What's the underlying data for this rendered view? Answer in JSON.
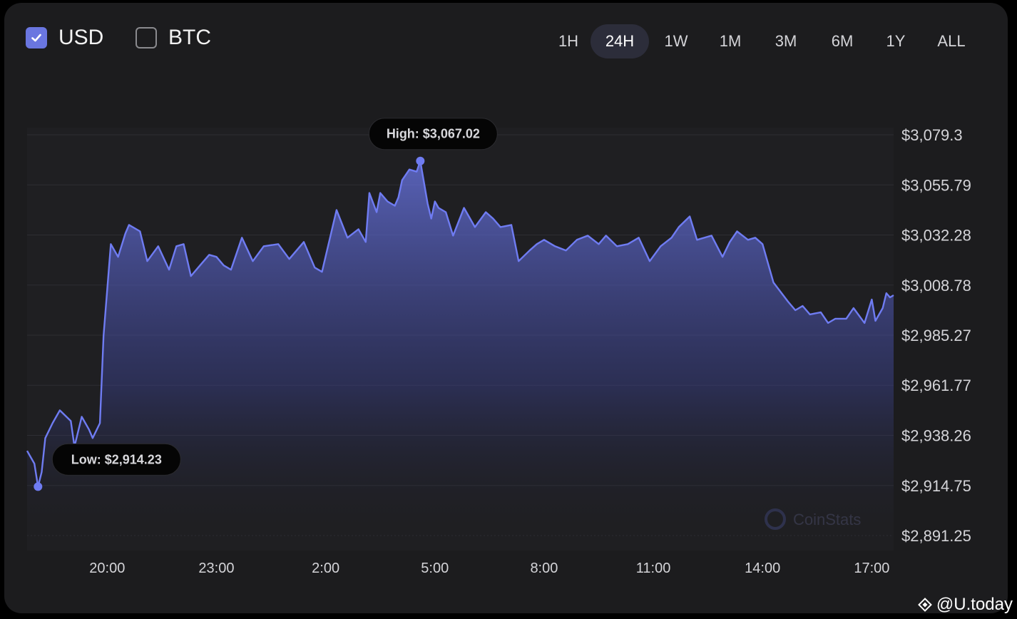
{
  "currency_toggles": [
    {
      "label": "USD",
      "checked": true
    },
    {
      "label": "BTC",
      "checked": false
    }
  ],
  "ranges": [
    "1H",
    "24H",
    "1W",
    "1M",
    "3M",
    "6M",
    "1Y",
    "ALL"
  ],
  "active_range": "24H",
  "watermark": "CoinStats",
  "brand": "@U.today",
  "colors": {
    "line": "#6f7cf2",
    "accent": "#6a76e0",
    "background": "#1c1c1e"
  },
  "chart_data": {
    "type": "area",
    "y_tick_labels": [
      "$3,079.3",
      "$3,055.79",
      "$3,032.28",
      "$3,008.78",
      "$2,985.27",
      "$2,961.77",
      "$2,938.26",
      "$2,914.75",
      "$2,891.25"
    ],
    "y_ticks": [
      3079.3,
      3055.79,
      3032.28,
      3008.78,
      2985.27,
      2961.77,
      2938.26,
      2914.75,
      2891.25
    ],
    "ylim": [
      2891.25,
      3079.3
    ],
    "x_tick_labels": [
      "20:00",
      "23:00",
      "2:00",
      "5:00",
      "8:00",
      "11:00",
      "14:00",
      "17:00"
    ],
    "x_ticks": [
      20,
      23,
      26,
      29,
      32,
      35,
      38,
      41
    ],
    "xlim": [
      17.8,
      41.6
    ],
    "grid": true,
    "series": [
      {
        "x": [
          17.8,
          18.0,
          18.1,
          18.2,
          18.3,
          18.5,
          18.7,
          19.0,
          19.1,
          19.3,
          19.5,
          19.6,
          19.8,
          19.9,
          20.1,
          20.3,
          20.5,
          20.6,
          20.9,
          21.1,
          21.4,
          21.7,
          21.9,
          22.1,
          22.3,
          22.6,
          22.8,
          23.0,
          23.2,
          23.4,
          23.7,
          24.0,
          24.3,
          24.7,
          25.0,
          25.4,
          25.7,
          25.9,
          26.3,
          26.6,
          26.9,
          27.1,
          27.2,
          27.4,
          27.5,
          27.7,
          27.9,
          28.0,
          28.1,
          28.3,
          28.5,
          28.6,
          28.8,
          28.9,
          29.0,
          29.1,
          29.3,
          29.5,
          29.8,
          30.1,
          30.4,
          30.6,
          30.8,
          31.1,
          31.3,
          31.6,
          31.8,
          32.0,
          32.3,
          32.6,
          32.9,
          33.2,
          33.5,
          33.7,
          34.0,
          34.3,
          34.6,
          34.9,
          35.2,
          35.5,
          35.7,
          36.0,
          36.2,
          36.6,
          36.9,
          37.1,
          37.3,
          37.6,
          37.8,
          38.0,
          38.3,
          38.7,
          38.9,
          39.1,
          39.3,
          39.6,
          39.8,
          40.0,
          40.3,
          40.5,
          40.8,
          41.0,
          41.1,
          41.3,
          41.4,
          41.5,
          41.6
        ],
        "y": [
          2931,
          2925,
          2914.23,
          2921,
          2937,
          2944,
          2950,
          2945,
          2933,
          2947,
          2941,
          2937,
          2944,
          2985,
          3028,
          3022,
          3033,
          3037,
          3034,
          3020,
          3027,
          3016,
          3027,
          3028,
          3013,
          3019,
          3023,
          3022,
          3018,
          3016,
          3031,
          3020,
          3027,
          3028,
          3021,
          3029,
          3017,
          3015,
          3044,
          3031,
          3035,
          3029,
          3052,
          3043,
          3052,
          3048,
          3046,
          3050,
          3058,
          3063,
          3062,
          3067.02,
          3047,
          3040,
          3048,
          3045,
          3043,
          3032,
          3045,
          3036,
          3043,
          3040,
          3036,
          3037,
          3020,
          3025,
          3028,
          3030,
          3027,
          3025,
          3030,
          3032,
          3028,
          3032,
          3027,
          3028,
          3031,
          3020,
          3027,
          3031,
          3036,
          3041,
          3030,
          3032,
          3022,
          3029,
          3034,
          3030,
          3031,
          3028,
          3010,
          3001,
          2997,
          2999,
          2995,
          2996,
          2991,
          2993,
          2993,
          2998,
          2991,
          3002,
          2992,
          2998,
          3005,
          3003,
          3004
        ]
      }
    ],
    "annotations": [
      {
        "label": "High: $3,067.02",
        "x": 28.6,
        "y": 3067.02
      },
      {
        "label": "Low: $2,914.23",
        "x": 18.1,
        "y": 2914.23
      }
    ]
  }
}
